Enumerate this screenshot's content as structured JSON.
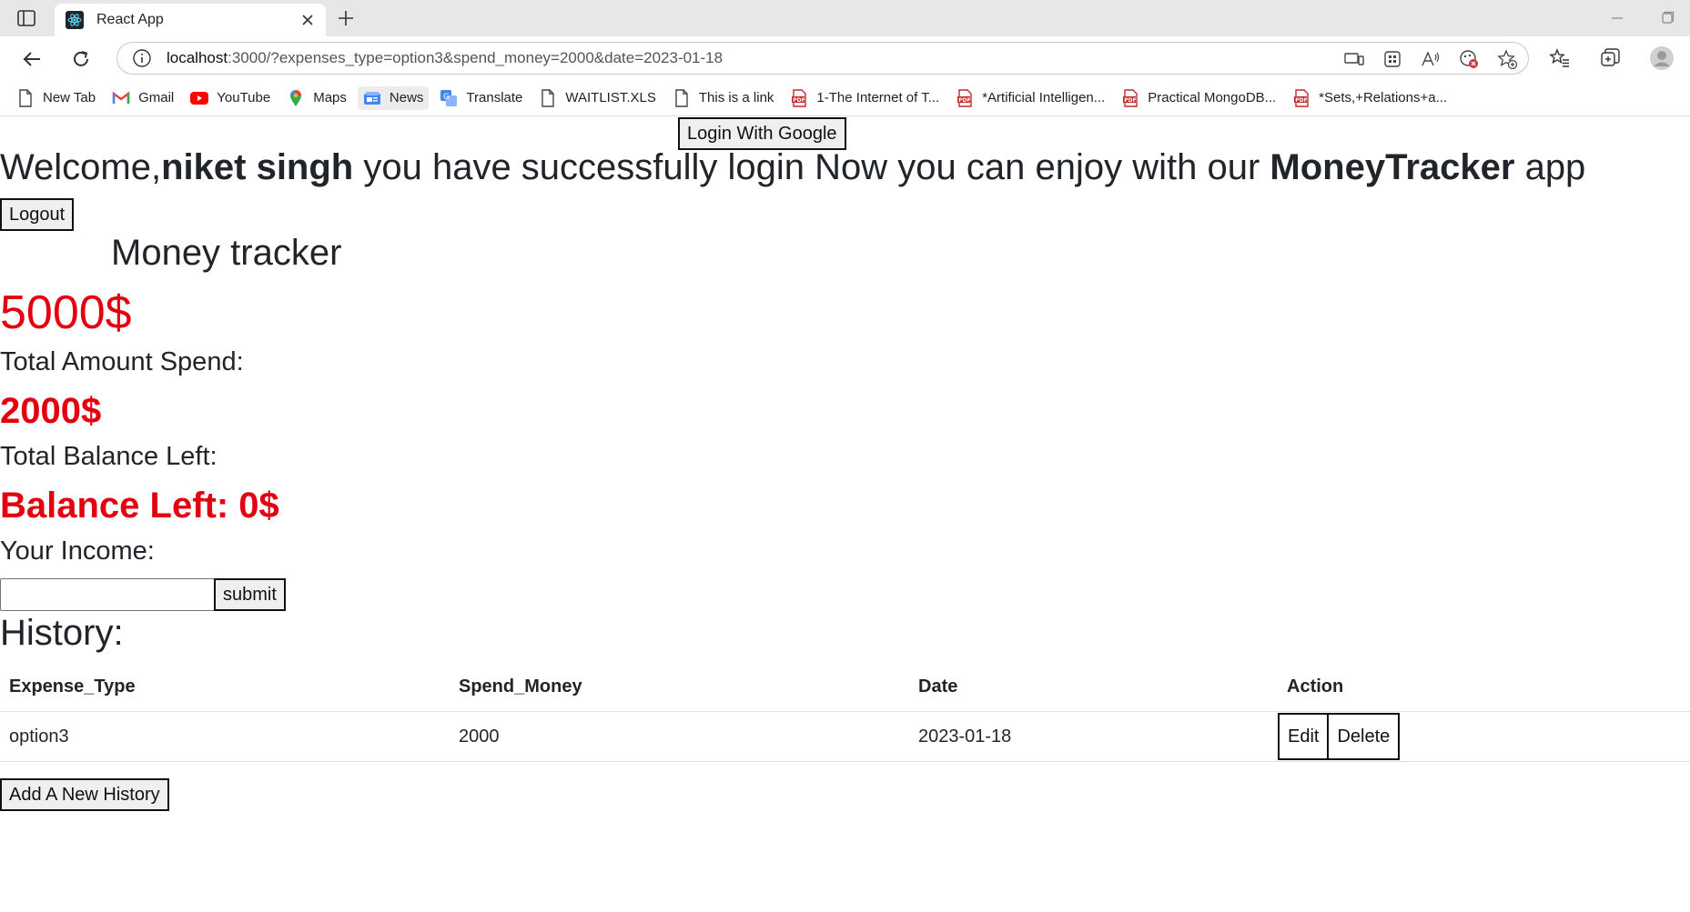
{
  "browser": {
    "tab_title": "React App",
    "url_host": "localhost",
    "url_rest": ":3000/?expenses_type=option3&spend_money=2000&date=2023-01-18",
    "bookmarks": [
      {
        "label": "New Tab",
        "icon": "page-icon"
      },
      {
        "label": "Gmail",
        "icon": "gmail-icon"
      },
      {
        "label": "YouTube",
        "icon": "youtube-icon"
      },
      {
        "label": "Maps",
        "icon": "maps-icon"
      },
      {
        "label": "News",
        "icon": "news-icon"
      },
      {
        "label": "Translate",
        "icon": "translate-icon"
      },
      {
        "label": "WAITLIST.XLS",
        "icon": "page-icon"
      },
      {
        "label": "This is a link",
        "icon": "page-icon"
      },
      {
        "label": "1-The Internet of T...",
        "icon": "pdf-icon"
      },
      {
        "label": "*Artificial Intelligen...",
        "icon": "pdf-icon"
      },
      {
        "label": "Practical MongoDB...",
        "icon": "pdf-icon"
      },
      {
        "label": "*Sets,+Relations+a...",
        "icon": "pdf-icon"
      }
    ]
  },
  "app": {
    "login_button": "Login With Google",
    "welcome": {
      "prefix": "Welcome,",
      "user": "niket singh",
      "middle": " you have successfully login Now you can enjoy with our ",
      "app_name": "MoneyTracker",
      "suffix": " app"
    },
    "logout_button": "Logout",
    "title": "Money tracker",
    "income_value": "5000$",
    "spend_label": "Total Amount Spend:",
    "spend_value": "2000$",
    "balance_label": "Total Balance Left:",
    "balance_value": "Balance Left: 0$",
    "income_label": "Your Income:",
    "income_input": {
      "value": "",
      "placeholder": ""
    },
    "submit_button": "submit",
    "history_title": "History:",
    "table": {
      "headers": [
        "Expense_Type",
        "Spend_Money",
        "Date",
        "Action"
      ],
      "rows": [
        {
          "expense_type": "option3",
          "spend_money": "2000",
          "date": "2023-01-18",
          "edit": "Edit",
          "delete": "Delete"
        }
      ]
    },
    "add_history_button": "Add A New History",
    "accent_color": "#e3000f"
  }
}
